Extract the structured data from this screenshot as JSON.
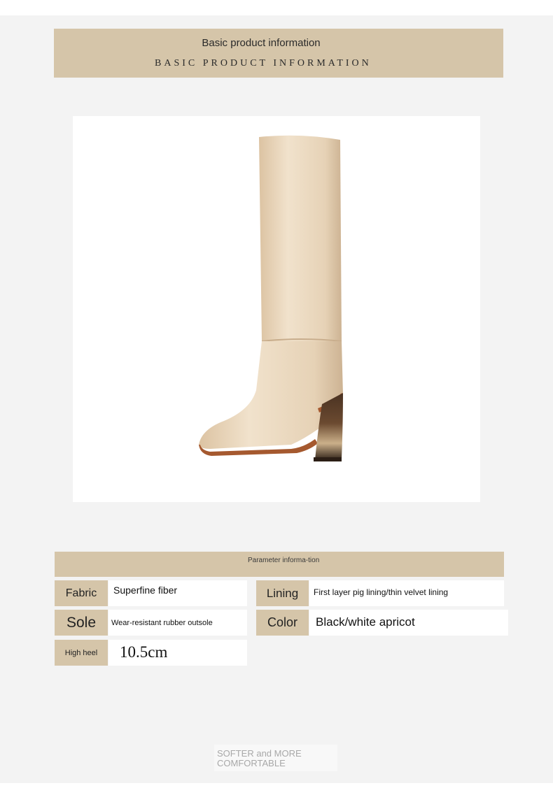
{
  "header": {
    "title": "Basic product information",
    "subtitle": "BASIC PRODUCT INFORMATION"
  },
  "product": {
    "image_label": "boot-product-image",
    "colors": {
      "shaft": "#ead7bd",
      "sole": "#a5592f",
      "heel_dark": "#3d2a1c",
      "heel_light": "#c9b08d"
    }
  },
  "parameters": {
    "title": "Parameter informa-tion",
    "rows": [
      {
        "label": "Fabric",
        "value": "Superfine fiber"
      },
      {
        "label": "Lining",
        "value": "First layer pig lining/thin velvet lining"
      },
      {
        "label": "Sole",
        "value": "Wear-resistant rubber outsole"
      },
      {
        "label": "Color",
        "value": "Black/white apricot"
      },
      {
        "label": "High heel",
        "value": "10.5cm"
      }
    ]
  },
  "footer": {
    "tagline": "SOFTER and MORE COMFORTABLE"
  },
  "theme": {
    "accent": "#d5c5a9",
    "panel_bg": "#f3f3f3"
  }
}
